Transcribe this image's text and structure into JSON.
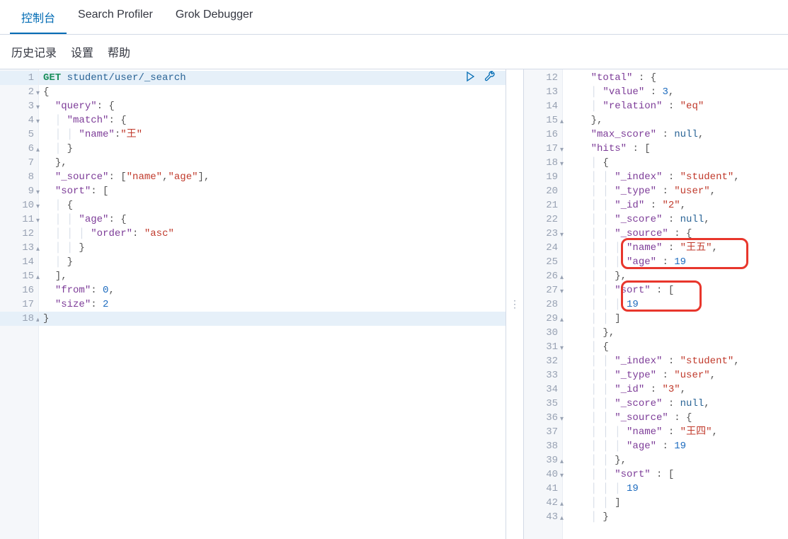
{
  "tabs": {
    "console": "控制台",
    "search_profiler": "Search Profiler",
    "grok_debugger": "Grok Debugger"
  },
  "subnav": {
    "history": "历史记录",
    "settings": "设置",
    "help": "帮助"
  },
  "request": {
    "method": "GET",
    "path": "student/user/_search",
    "body": {
      "query": {
        "match": {
          "name": "王"
        }
      },
      "_source": [
        "name",
        "age"
      ],
      "sort": [
        {
          "age": {
            "order": "asc"
          }
        }
      ],
      "from": 0,
      "size": 2
    },
    "line_numbers": [
      "1",
      "2",
      "3",
      "4",
      "5",
      "6",
      "7",
      "8",
      "9",
      "10",
      "11",
      "12",
      "13",
      "14",
      "15",
      "16",
      "17",
      "18"
    ],
    "fold_lines": [
      "2",
      "3",
      "4",
      "6",
      "9",
      "10",
      "11",
      "13",
      "15",
      "18"
    ],
    "highlight_lines": [
      "1",
      "18"
    ]
  },
  "response": {
    "line_numbers": [
      "12",
      "13",
      "14",
      "15",
      "16",
      "17",
      "18",
      "19",
      "20",
      "21",
      "22",
      "23",
      "24",
      "25",
      "26",
      "27",
      "28",
      "29",
      "30",
      "31",
      "32",
      "33",
      "34",
      "35",
      "36",
      "37",
      "38",
      "39",
      "40",
      "41",
      "42",
      "43"
    ],
    "fold_lines": [
      "15",
      "17",
      "18",
      "23",
      "26",
      "27",
      "29",
      "31",
      "36",
      "39",
      "40",
      "42",
      "43"
    ],
    "hits": {
      "total": {
        "value": 3,
        "relation": "eq"
      },
      "max_score": null,
      "hits": [
        {
          "_index": "student",
          "_type": "user",
          "_id": "2",
          "_score": null,
          "_source": {
            "name": "王五",
            "age": 19
          },
          "sort": [
            19
          ]
        },
        {
          "_index": "student",
          "_type": "user",
          "_id": "3",
          "_score": null,
          "_source": {
            "name": "王四",
            "age": 19
          },
          "sort": [
            19
          ]
        }
      ]
    }
  },
  "colors": {
    "accent": "#006bb4",
    "highlight_border": "#e8362c"
  }
}
